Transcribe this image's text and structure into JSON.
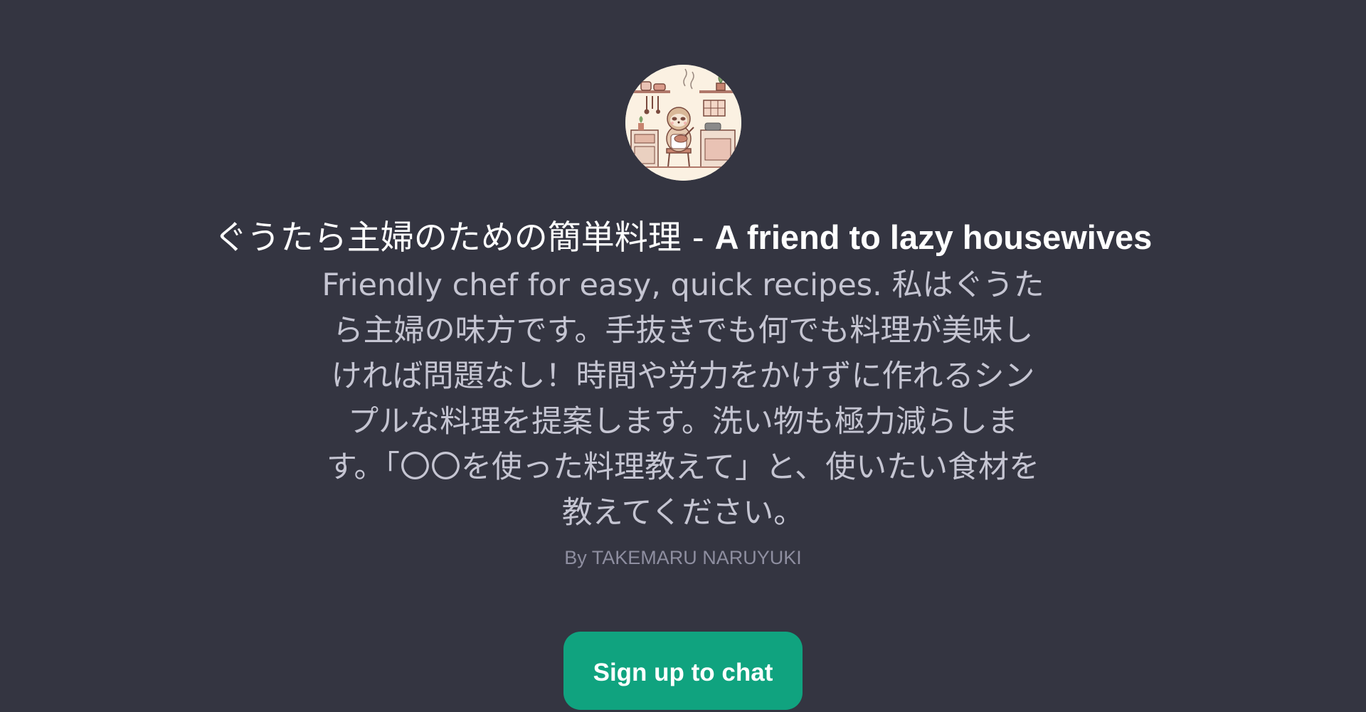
{
  "gpt": {
    "avatar_icon": "sloth-chef-kitchen-avatar-icon",
    "title_ja": "ぐうたら主婦のための簡単料理 - ",
    "title_en": "A friend to lazy housewives",
    "description": "Friendly chef for easy, quick recipes. 私はぐうたら主婦の味方です。手抜きでも何でも料理が美味しければ問題なし！時間や労力をかけずに作れるシンプルな料理を提案します。洗い物も極力減らします。「〇〇を使った料理教えて」と、使いたい食材を教えてください。",
    "author": "By TAKEMARU NARUYUKI"
  },
  "cta": {
    "label": "Sign up to chat"
  },
  "colors": {
    "background": "#343541",
    "title": "#ffffff",
    "description": "#c5c5d2",
    "author": "#8e8ea0",
    "button": "#10a37f"
  }
}
